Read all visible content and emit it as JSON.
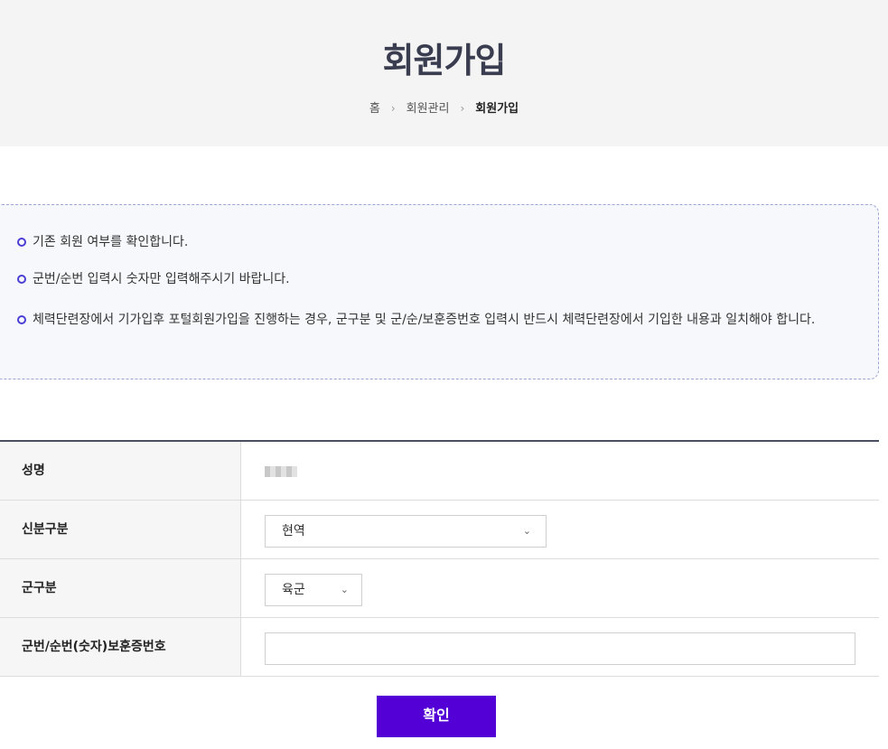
{
  "header": {
    "title": "회원가입",
    "breadcrumb": {
      "home": "홈",
      "section": "회원관리",
      "current": "회원가입",
      "separator": "›"
    }
  },
  "notice": {
    "items": [
      "기존 회원 여부를 확인합니다.",
      "군번/순번 입력시 숫자만 입력해주시기 바랍니다.",
      "체력단련장에서 기가입후 포털회원가입을 진행하는 경우, 군구분 및 군/순/보훈증번호 입력시 반드시 체력단련장에서 기입한 내용과 일치해야 합니다."
    ],
    "bullet_color": "#4c3fd6"
  },
  "form": {
    "name_label": "성명",
    "status_label": "신분구분",
    "status_value": "현역",
    "branch_label": "군구분",
    "branch_value": "육군",
    "id_number_label": "군번/순번(숫자)보훈증번호",
    "id_number_value": ""
  },
  "actions": {
    "confirm_label": "확인",
    "confirm_color": "#5200d6"
  },
  "icons": {
    "chevron": "⌄"
  }
}
